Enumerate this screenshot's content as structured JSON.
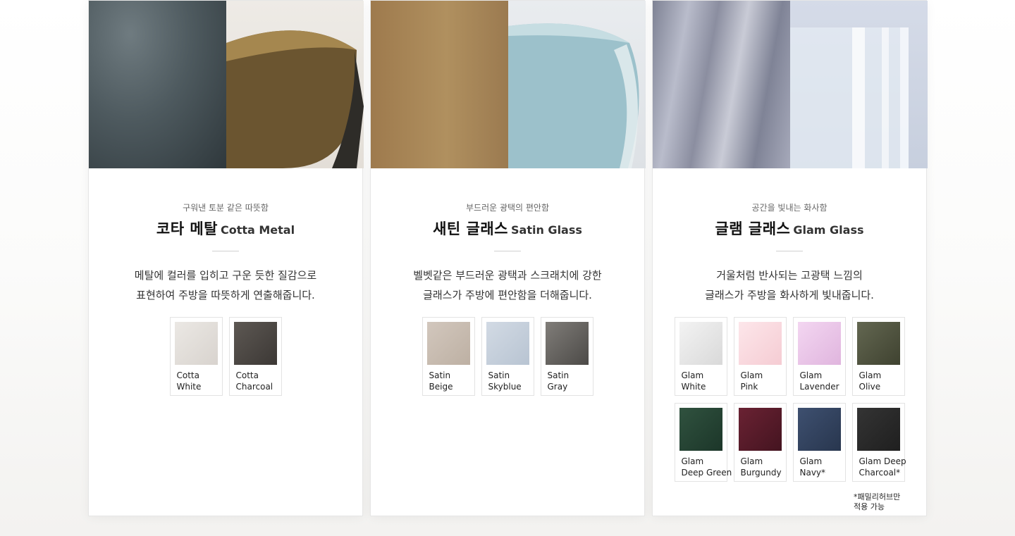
{
  "panels": [
    {
      "subtitle": "구워낸 토분 같은 따뜻함",
      "title_ko": "코타 메탈",
      "title_en": "Cotta Metal",
      "desc": [
        "메탈에 컬러를 입히고 구운 듯한 질감으로",
        "표현하여 주방을 따뜻하게 연출해줍니다."
      ],
      "swatches": [
        {
          "line1": "Cotta",
          "line2": "White",
          "color": "#dedad5"
        },
        {
          "line1": "Cotta",
          "line2": "Charcoal",
          "color": "#4f4a46"
        }
      ]
    },
    {
      "subtitle": "부드러운 광택의 편안함",
      "title_ko": "새틴 글래스",
      "title_en": "Satin Glass",
      "desc": [
        "벨벳같은 부드러운 광택과 스크래치에 강한",
        "글래스가 주방에 편안함을 더해줍니다."
      ],
      "swatches": [
        {
          "line1": "Satin",
          "line2": "Beige",
          "color": "#c8bcb1"
        },
        {
          "line1": "Satin",
          "line2": "Skyblue",
          "color": "#c4cedb"
        },
        {
          "line1": "Satin",
          "line2": "Gray",
          "color": "#666461"
        }
      ]
    },
    {
      "subtitle": "공간을 빛내는 화사함",
      "title_ko": "글램 글래스",
      "title_en": "Glam Glass",
      "desc": [
        "거울처럼 반사되는 고광택 느낌의",
        "글래스가 주방을 화사하게 빛내줍니다."
      ],
      "swatches": [
        {
          "line1": "Glam",
          "line2": "White",
          "color": "#e6e6e6"
        },
        {
          "line1": "Glam",
          "line2": "Pink",
          "color": "#f8d7dc"
        },
        {
          "line1": "Glam",
          "line2": "Lavender",
          "color": "#e7c3e6"
        },
        {
          "line1": "Glam",
          "line2": "Olive",
          "color": "#535640"
        },
        {
          "line1": "Glam",
          "line2": "Deep Green",
          "color": "#264537"
        },
        {
          "line1": "Glam",
          "line2": "Burgundy",
          "color": "#5a1b2a"
        },
        {
          "line1": "Glam",
          "line2": "Navy*",
          "color": "#33435f"
        },
        {
          "line1": "Glam Deep",
          "line2": "Charcoal*",
          "color": "#2a2a2a"
        }
      ],
      "note": [
        "*패밀리허브만",
        "적용 가능"
      ]
    }
  ]
}
